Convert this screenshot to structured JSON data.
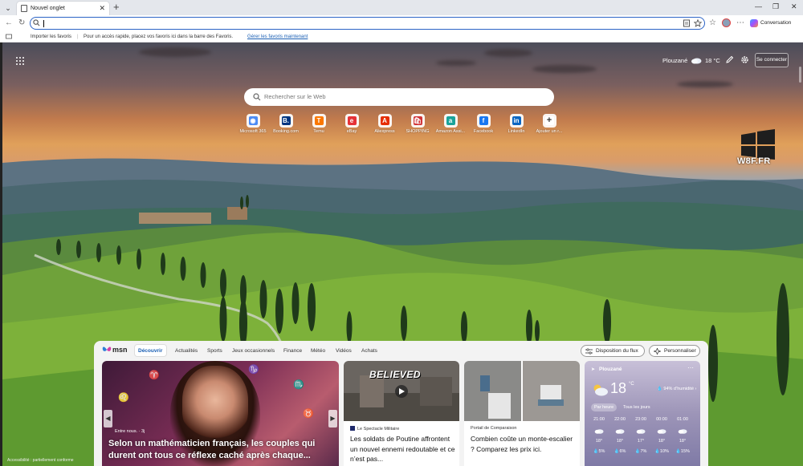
{
  "browser": {
    "tab_title": "Nouvel onglet",
    "conversation_label": "Conversation"
  },
  "favorites_bar": {
    "import_label": "Importer les favoris",
    "hint_text": "Pour un accès rapide, placez vos favoris ici dans la barre des Favoris.",
    "manage_link": "Gérer les favoris maintenant"
  },
  "newtab": {
    "weather_location": "Plouzané",
    "weather_temp": "18 °C",
    "signin_label": "Se connecter",
    "search_placeholder": "Rechercher sur le Web",
    "quick_links": [
      {
        "label": "Microsoft 365",
        "icon": "microsoft-365-icon",
        "color": "#4b8bf5",
        "glyph": "◉"
      },
      {
        "label": "Booking.com",
        "icon": "booking-icon",
        "color": "#003580",
        "glyph": "B."
      },
      {
        "label": "Temu",
        "icon": "temu-icon",
        "color": "#fb7701",
        "glyph": "T"
      },
      {
        "label": "eBay",
        "icon": "ebay-icon",
        "color": "#e53238",
        "glyph": "e"
      },
      {
        "label": "Aliexpress",
        "icon": "aliexpress-icon",
        "color": "#e62e04",
        "glyph": "A"
      },
      {
        "label": "SHOPPING",
        "icon": "shopping-icon",
        "color": "#d13438",
        "glyph": "🛍"
      },
      {
        "label": "Amazon Assi...",
        "icon": "amazon-icon",
        "color": "#1aa39a",
        "glyph": "a"
      },
      {
        "label": "Facebook",
        "icon": "facebook-icon",
        "color": "#1877f2",
        "glyph": "f"
      },
      {
        "label": "LinkedIn",
        "icon": "linkedin-icon",
        "color": "#0a66c2",
        "glyph": "in"
      },
      {
        "label": "Ajouter un r...",
        "icon": "add-icon",
        "color": "#ffffff",
        "glyph": "+"
      }
    ],
    "watermark": "W8F.FR"
  },
  "feed": {
    "brand": "msn",
    "tabs": [
      "Découvrir",
      "Actualités",
      "Sports",
      "Jeux occasionnels",
      "Finance",
      "Météo",
      "Vidéos",
      "Achats"
    ],
    "layout_button": "Disposition du flux",
    "personalize_button": "Personnaliser",
    "hero": {
      "source": "Entre nous. · 3j",
      "title": "Selon un mathématicien français, les couples qui durent ont tous ce réflexe caché après chaque..."
    },
    "cards": [
      {
        "source": "Le Spectacle Militaire",
        "title": "Les soldats de Poutine affrontent un nouvel ennemi redoutable et ce n’est pas...",
        "overlay": "BELIEVED"
      },
      {
        "source": "Portail de Comparaison",
        "title": "Combien coûte un monte-escalier ? Comparez les prix ici."
      }
    ],
    "weather": {
      "location": "Plouzané",
      "temp": "18",
      "unit": "°C",
      "humidity": "94% d’humidité",
      "tab_hourly": "Par heure",
      "tab_daily": "Tous les jours",
      "hours": [
        {
          "time": "21:00",
          "temp": "18°",
          "rain": "5%"
        },
        {
          "time": "22:00",
          "temp": "18°",
          "rain": "6%"
        },
        {
          "time": "23:00",
          "temp": "17°",
          "rain": "7%"
        },
        {
          "time": "00:00",
          "temp": "18°",
          "rain": "10%"
        },
        {
          "time": "01:00",
          "temp": "18°",
          "rain": "15%"
        }
      ]
    }
  },
  "accessibility_note": "Accessibilité : partiellement conforme"
}
